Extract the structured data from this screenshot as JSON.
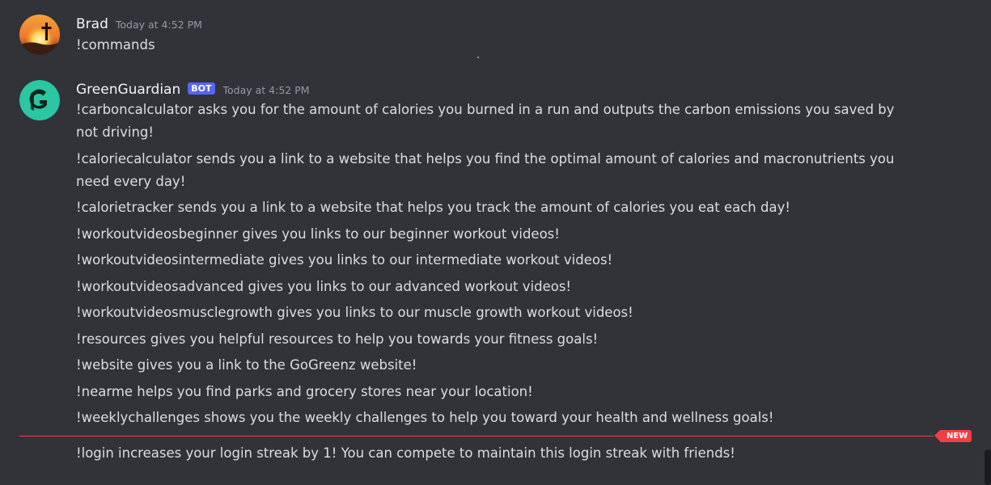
{
  "messages": [
    {
      "author": "Brad",
      "timestamp": "Today at 4:52 PM",
      "text": "!commands"
    },
    {
      "author": "GreenGuardian",
      "bot_tag": "BOT",
      "timestamp": "Today at 4:52 PM",
      "lines": [
        "!carboncalculator asks you for the amount of calories you burned in a run and outputs the carbon emissions you saved by not driving!",
        "!caloriecalculator sends you a link to a website that helps you find the optimal amount of calories and macronutrients you need every day!",
        "!calorietracker sends you a link to a website that helps you track the amount of calories you eat each day!",
        "!workoutvideosbeginner gives you links to our beginner workout videos!",
        "!workoutvideosintermediate gives you links to our intermediate workout videos!",
        "!workoutvideosadvanced gives you links to our advanced workout videos!",
        "!workoutvideosmusclegrowth gives you links to our muscle growth workout videos!",
        "!resources gives you helpful resources to help you towards your fitness goals!",
        "!website gives you a link to the GoGreenz website!",
        "!nearme helps you find parks and grocery stores near your location!",
        "!weeklychallenges shows you the weekly challenges to help you toward your health and wellness goals!"
      ],
      "after_new": "!login increases your login streak by 1! You can compete to maintain this login streak with friends!"
    }
  ],
  "new_divider_label": "NEW",
  "colors": {
    "background": "#313338",
    "text": "#dbdee1",
    "username": "#f2f3f5",
    "timestamp": "#949ba4",
    "bot_tag": "#5865f2",
    "new_divider": "#f23f43",
    "bot_avatar": "#2bc7a4"
  },
  "icons": {
    "brad_avatar": "sunset-cross-avatar",
    "bot_avatar": "green-g-logo-avatar"
  }
}
